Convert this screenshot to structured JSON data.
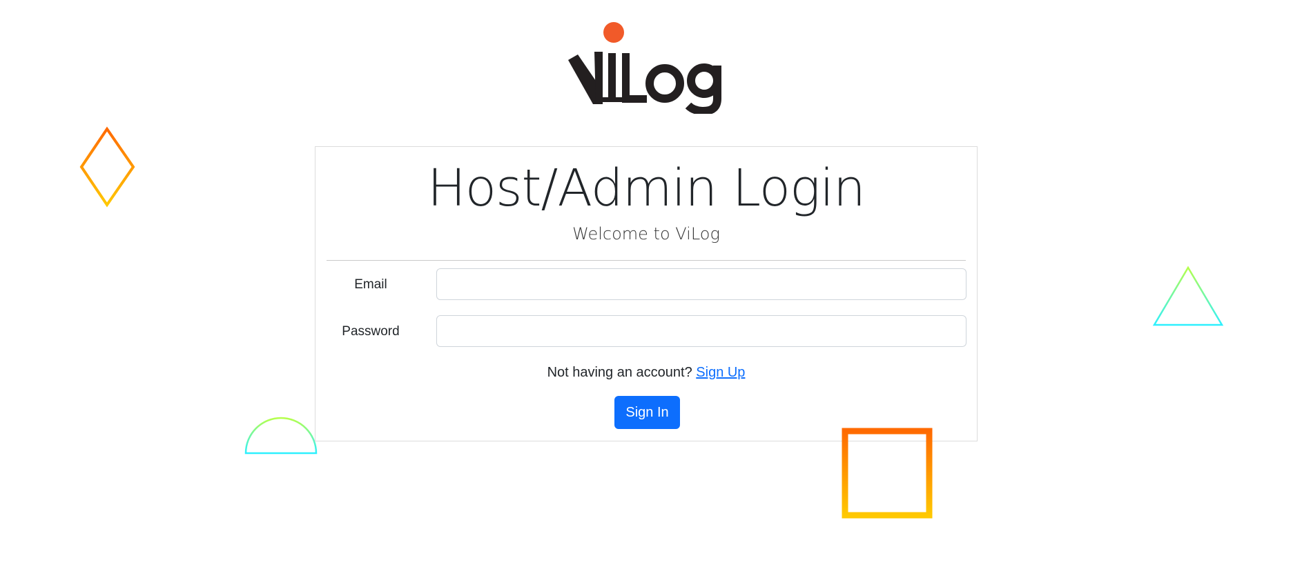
{
  "logo": {
    "text": "ViLog",
    "dot_color": "#f15a29",
    "text_color": "#231f20"
  },
  "login": {
    "title": "Host/Admin Login",
    "subtitle": "Welcome to ViLog",
    "email_label": "Email",
    "email_value": "",
    "password_label": "Password",
    "password_value": "",
    "signup_prompt": "Not having an account?",
    "signup_link": "Sign Up",
    "signin_button": "Sign In"
  },
  "colors": {
    "primary": "#0d6efd",
    "card_border": "#dcdcdc",
    "orange": "#ff6a00",
    "yellow": "#ffc800",
    "lime": "#b6ff4a",
    "cyan": "#2df0ff"
  }
}
